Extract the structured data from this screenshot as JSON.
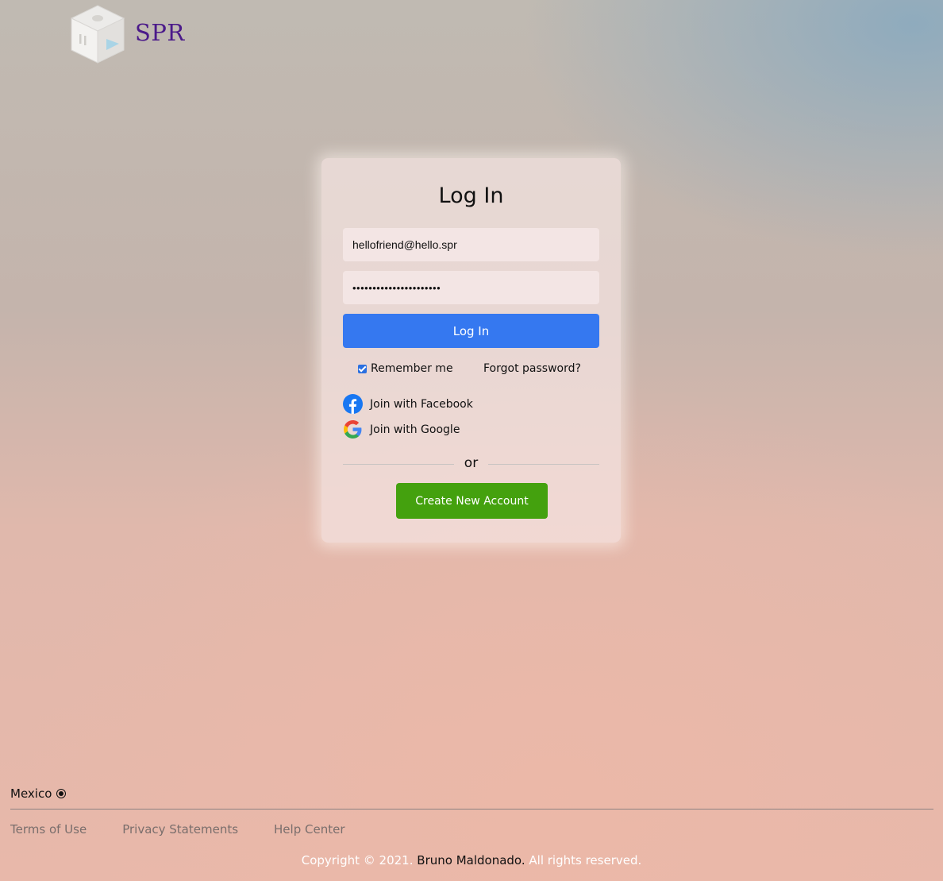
{
  "brand": {
    "logo_icon": "cube-logo-icon",
    "name": "SPR",
    "name_color": "#4b1a8a"
  },
  "login": {
    "title": "Log In",
    "email_value": "hellofriend@hello.spr",
    "password_value": "••••••••••••••••••••••",
    "submit_label": "Log In",
    "submit_color": "#3578f0",
    "remember_label": "Remember me",
    "remember_checked": true,
    "forgot_label": "Forgot password?",
    "facebook_label": "Join with Facebook",
    "facebook_icon": "facebook-icon",
    "google_label": "Join with Google",
    "google_icon": "google-icon",
    "divider_text": "or",
    "create_label": "Create New Account",
    "create_color": "#44a10e"
  },
  "footer": {
    "country": "Mexico",
    "links": [
      "Terms of Use",
      "Privacy Statements",
      "Help Center"
    ],
    "copyright_prefix": "Copyright © 2021.",
    "copyright_author": "Bruno Maldonado.",
    "copyright_suffix": "All rights reserved."
  }
}
